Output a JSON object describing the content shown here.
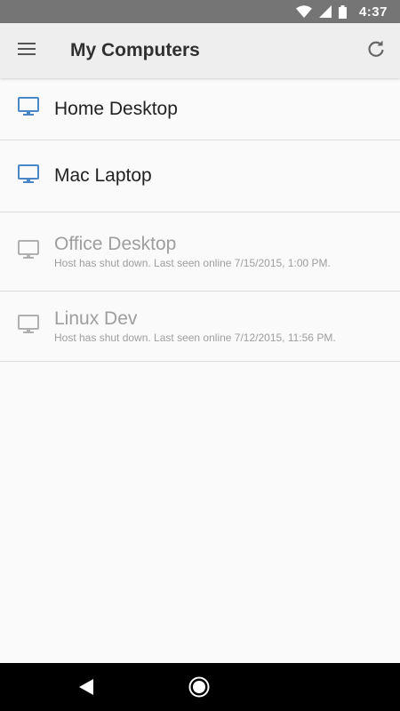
{
  "status_bar": {
    "time": "4:37"
  },
  "app_bar": {
    "title": "My Computers"
  },
  "hosts": [
    {
      "name": "Home Desktop",
      "status": "",
      "online": true
    },
    {
      "name": "Mac Laptop",
      "status": "",
      "online": true
    },
    {
      "name": "Office Desktop",
      "status": "Host has shut down. Last seen online 7/15/2015, 1:00 PM.",
      "online": false
    },
    {
      "name": "Linux Dev",
      "status": "Host has shut down. Last seen online 7/12/2015, 11:56 PM.",
      "online": false
    }
  ],
  "colors": {
    "online_icon": "#4a86c8",
    "offline_icon": "#b0b0b0",
    "status_bar": "#757575",
    "app_bar": "#eeeeee"
  },
  "icons": {
    "menu": "menu-icon",
    "refresh": "refresh-icon",
    "host": "monitor-icon",
    "wifi": "wifi-icon",
    "signal": "signal-icon",
    "battery": "battery-icon",
    "back": "back-icon",
    "home": "home-icon"
  }
}
